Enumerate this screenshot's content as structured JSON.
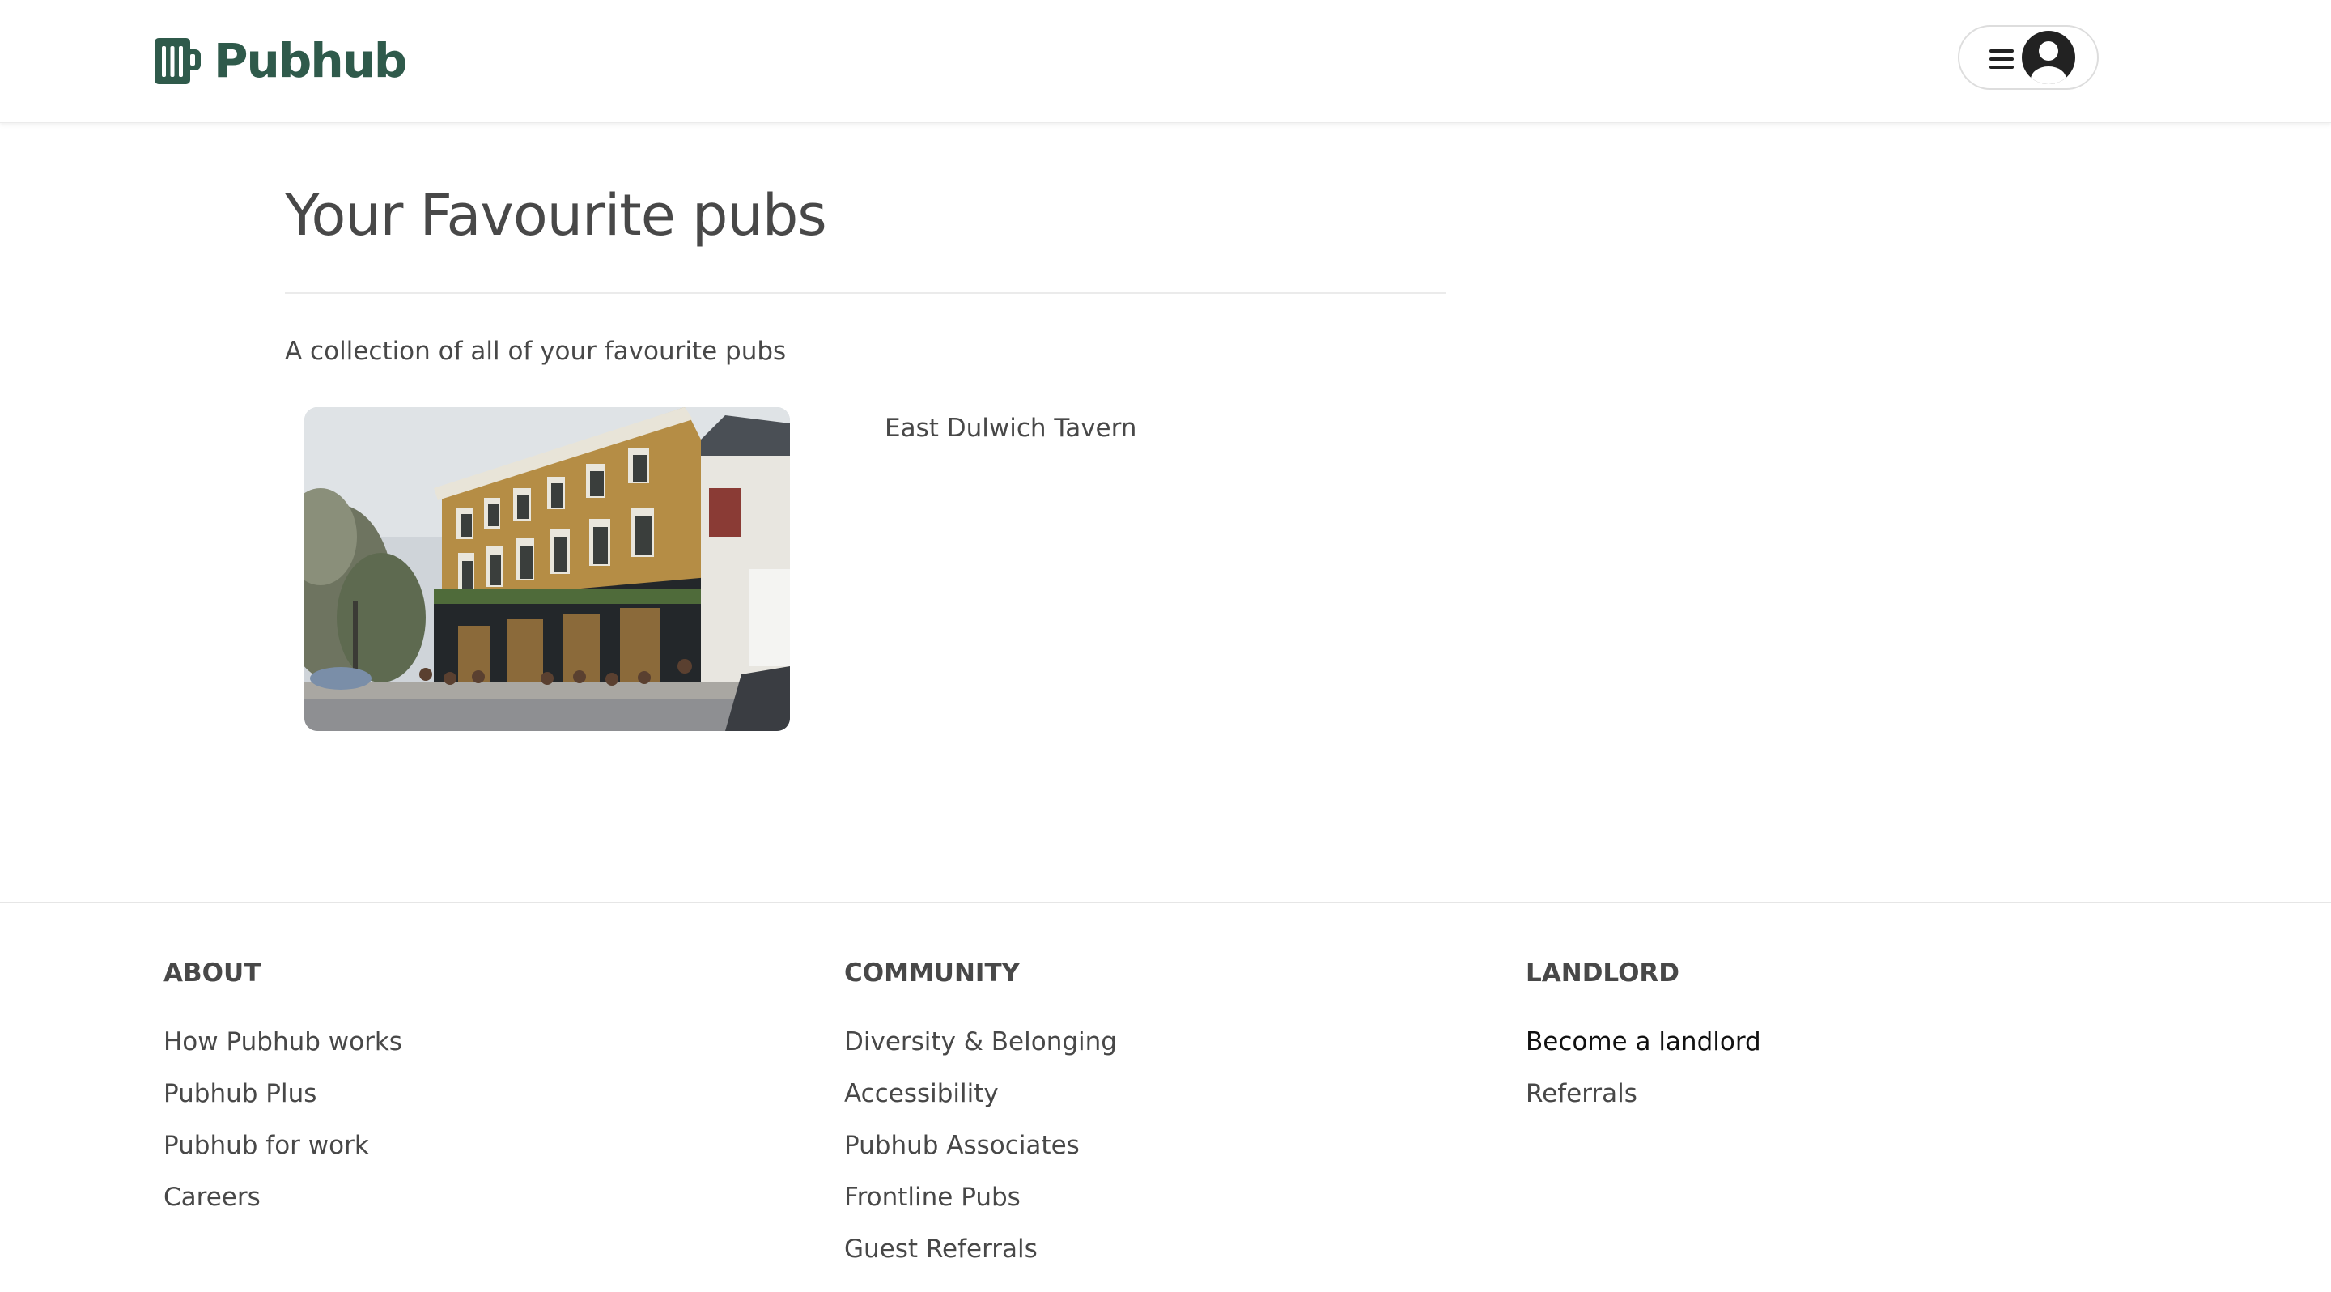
{
  "header": {
    "logo_text": "Pubhub",
    "brand_color": "#2f5a4b",
    "icons": [
      "beer-mug-logo-icon",
      "hamburger-menu-icon",
      "user-avatar-icon"
    ]
  },
  "main": {
    "title": "Your Favourite pubs",
    "subtitle": "A collection of all of your favourite pubs",
    "pubs": [
      {
        "name": "East Dulwich Tavern"
      }
    ]
  },
  "footer": {
    "columns": [
      {
        "heading": "ABOUT",
        "links": [
          "How Pubhub works",
          "Pubhub Plus",
          "Pubhub for work",
          "Careers"
        ]
      },
      {
        "heading": "COMMUNITY",
        "links": [
          "Diversity & Belonging",
          "Accessibility",
          "Pubhub Associates",
          "Frontline Pubs",
          "Guest Referrals"
        ]
      },
      {
        "heading": "LANDLORD",
        "links": [
          "Become a landlord",
          "Referrals"
        ]
      }
    ]
  }
}
